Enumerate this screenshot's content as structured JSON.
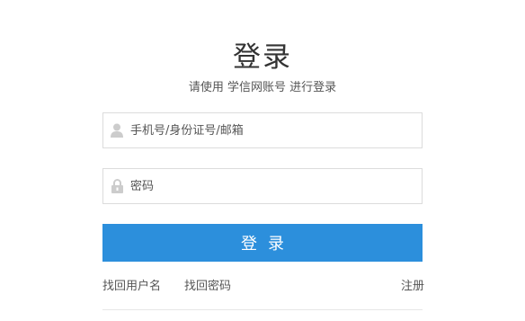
{
  "header": {
    "title": "登录",
    "subtitle": "请使用 学信网账号 进行登录"
  },
  "form": {
    "username": {
      "placeholder": "手机号/身份证号/邮箱",
      "value": "",
      "icon": "user-icon"
    },
    "password": {
      "placeholder": "密码",
      "value": "",
      "icon": "lock-icon"
    },
    "submit_label": "登录"
  },
  "links": {
    "find_username": "找回用户名",
    "find_password": "找回密码",
    "register": "注册"
  },
  "colors": {
    "primary_button": "#2c8fdc",
    "border": "#dcdcdc",
    "icon": "#cccccc"
  }
}
